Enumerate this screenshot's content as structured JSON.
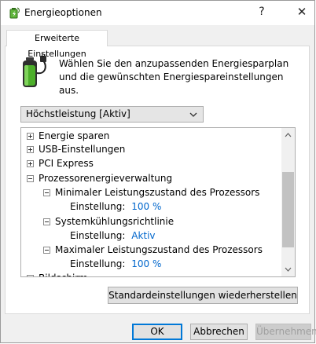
{
  "window": {
    "title": "Energieoptionen",
    "help_glyph": "?",
    "close_glyph": "✕"
  },
  "tab": {
    "label": "Erweiterte Einstellungen"
  },
  "description": "Wählen Sie den anzupassenden Energiesparplan und die gewünschten Energiespareinstellungen aus.",
  "plan_select": {
    "value": "Höchstleistung [Aktiv]"
  },
  "tree": {
    "items": [
      {
        "label": "Energie sparen",
        "expander": "plus"
      },
      {
        "label": "USB-Einstellungen",
        "expander": "plus"
      },
      {
        "label": "PCI Express",
        "expander": "plus"
      },
      {
        "label": "Prozessorenergieverwaltung",
        "expander": "minus"
      },
      {
        "label": "Minimaler Leistungszustand des Prozessors",
        "expander": "minus"
      },
      {
        "label": "Einstellung:",
        "value": "100 %"
      },
      {
        "label": "Systemkühlungsrichtlinie",
        "expander": "minus"
      },
      {
        "label": "Einstellung:",
        "value": "Aktiv"
      },
      {
        "label": "Maximaler Leistungszustand des Prozessors",
        "expander": "minus"
      },
      {
        "label": "Einstellung:",
        "value": "100 %"
      },
      {
        "label": "Bildschirm",
        "expander": "plus"
      }
    ]
  },
  "buttons": {
    "restore": "Standardeinstellungen wiederherstellen",
    "ok": "OK",
    "cancel": "Abbrechen",
    "apply": "Übernehmen"
  },
  "colors": {
    "value_link": "#0066cc",
    "focus_border": "#0078d7",
    "battery_green": "#4caf2a"
  },
  "icons": {
    "app": "power-options-icon",
    "battery": "battery-plug-icon",
    "expand": "plus-box-icon",
    "collapse": "minus-box-icon",
    "dropdown": "chevron-down-icon"
  }
}
